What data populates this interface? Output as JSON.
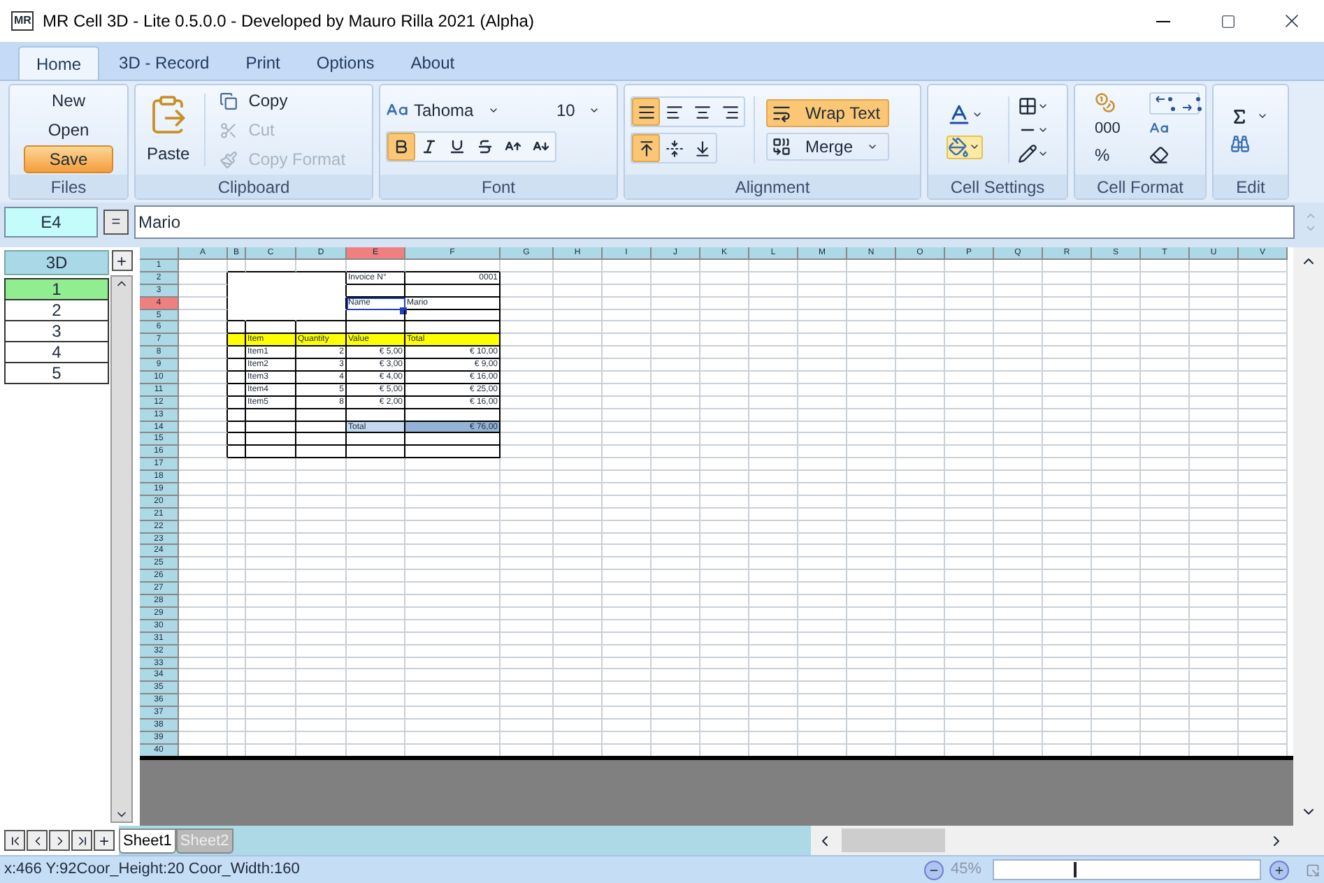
{
  "window": {
    "title": "MR Cell 3D - Lite 0.5.0.0 - Developed by Mauro Rilla 2021 (Alpha)",
    "app_icon": "MR"
  },
  "tabs": [
    {
      "label": "Home",
      "selected": true
    },
    {
      "label": "3D - Record",
      "selected": false
    },
    {
      "label": "Print",
      "selected": false
    },
    {
      "label": "Options",
      "selected": false
    },
    {
      "label": "About",
      "selected": false
    }
  ],
  "ribbon": {
    "files": {
      "label": "Files",
      "buttons": [
        {
          "label": "New",
          "active": false
        },
        {
          "label": "Open",
          "active": false
        },
        {
          "label": "Save",
          "active": true
        }
      ]
    },
    "clipboard": {
      "label": "Clipboard",
      "paste": "Paste",
      "items": [
        {
          "kind": "copy",
          "label": "Copy",
          "disabled": false
        },
        {
          "kind": "cut",
          "label": "Cut",
          "disabled": true
        },
        {
          "kind": "format",
          "label": "Copy Format",
          "disabled": true
        }
      ]
    },
    "font": {
      "label": "Font",
      "name": "Tahoma",
      "size": "10",
      "styles": [
        {
          "kind": "bold",
          "active": true
        },
        {
          "kind": "italic",
          "active": false
        },
        {
          "kind": "underline",
          "active": false
        },
        {
          "kind": "strike",
          "active": false
        },
        {
          "kind": "grow",
          "active": false
        },
        {
          "kind": "shrink",
          "active": false
        }
      ]
    },
    "alignment": {
      "label": "Alignment",
      "horizontal": [
        {
          "kind": "auto",
          "active": true
        },
        {
          "kind": "left",
          "active": false
        },
        {
          "kind": "center",
          "active": false
        },
        {
          "kind": "right",
          "active": false
        }
      ],
      "vertical": [
        {
          "kind": "top",
          "active": true
        },
        {
          "kind": "middle",
          "active": false
        },
        {
          "kind": "bottom",
          "active": false
        }
      ],
      "wrap": {
        "label": "Wrap Text",
        "active": true
      },
      "merge": {
        "label": "Merge"
      }
    },
    "cell_settings": {
      "label": "Cell Settings",
      "fill_active": true
    },
    "cell_format": {
      "label": "Cell Format",
      "thousands": "000",
      "percent": "%"
    },
    "edit": {
      "label": "Edit"
    }
  },
  "formula_bar": {
    "cell": "E4",
    "equals": "=",
    "value": "Mario"
  },
  "panel_3d": {
    "header": "3D",
    "add": "+",
    "items": [
      {
        "label": "1",
        "selected": true
      },
      {
        "label": "2",
        "selected": false
      },
      {
        "label": "3",
        "selected": false
      },
      {
        "label": "4",
        "selected": false
      },
      {
        "label": "5",
        "selected": false
      }
    ]
  },
  "grid": {
    "columns": [
      {
        "label": "A",
        "selected": false
      },
      {
        "label": "B",
        "selected": false
      },
      {
        "label": "C",
        "selected": false
      },
      {
        "label": "D",
        "selected": false
      },
      {
        "label": "E",
        "selected": true
      },
      {
        "label": "F",
        "selected": false
      },
      {
        "label": "G",
        "selected": false
      },
      {
        "label": "H",
        "selected": false
      },
      {
        "label": "I",
        "selected": false
      },
      {
        "label": "J",
        "selected": false
      },
      {
        "label": "K",
        "selected": false
      },
      {
        "label": "L",
        "selected": false
      },
      {
        "label": "M",
        "selected": false
      },
      {
        "label": "N",
        "selected": false
      },
      {
        "label": "O",
        "selected": false
      },
      {
        "label": "P",
        "selected": false
      },
      {
        "label": "Q",
        "selected": false
      },
      {
        "label": "R",
        "selected": false
      },
      {
        "label": "S",
        "selected": false
      },
      {
        "label": "T",
        "selected": false
      },
      {
        "label": "U",
        "selected": false
      },
      {
        "label": "V",
        "selected": false
      }
    ],
    "rows": [
      {
        "label": "1",
        "selected": false
      },
      {
        "label": "2",
        "selected": false,
        "cells": {
          "E": {
            "text": "Invoice N°",
            "kind": "text"
          },
          "F": {
            "text": "0001",
            "kind": "number"
          }
        }
      },
      {
        "label": "3",
        "selected": false
      },
      {
        "label": "4",
        "selected": true,
        "cells": {
          "E": {
            "text": "Name",
            "kind": "text",
            "selected": true
          },
          "F": {
            "text": "Mario",
            "kind": "text"
          }
        }
      },
      {
        "label": "5",
        "selected": false
      },
      {
        "label": "6",
        "selected": false
      },
      {
        "label": "7",
        "selected": false,
        "cells": {
          "B": {
            "color": "#ffff00"
          },
          "C": {
            "text": "Item",
            "kind": "text",
            "color": "#ffff00"
          },
          "D": {
            "text": "Quantity",
            "kind": "text",
            "color": "#ffff00"
          },
          "E": {
            "text": "Value",
            "kind": "text",
            "color": "#ffff00"
          },
          "F": {
            "text": "Total",
            "kind": "text",
            "color": "#ffff00"
          }
        }
      },
      {
        "label": "8",
        "selected": false,
        "cells": {
          "C": {
            "text": "Item1",
            "kind": "text"
          },
          "D": {
            "text": "2",
            "kind": "number"
          },
          "E": {
            "text": "€ 5,00",
            "kind": "number"
          },
          "F": {
            "text": "€ 10,00",
            "kind": "number"
          }
        }
      },
      {
        "label": "9",
        "selected": false,
        "cells": {
          "C": {
            "text": "Item2",
            "kind": "text"
          },
          "D": {
            "text": "3",
            "kind": "number"
          },
          "E": {
            "text": "€ 3,00",
            "kind": "number"
          },
          "F": {
            "text": "€ 9,00",
            "kind": "number"
          }
        }
      },
      {
        "label": "10",
        "selected": false,
        "cells": {
          "C": {
            "text": "Item3",
            "kind": "text"
          },
          "D": {
            "text": "4",
            "kind": "number"
          },
          "E": {
            "text": "€ 4,00",
            "kind": "number"
          },
          "F": {
            "text": "€ 16,00",
            "kind": "number"
          }
        }
      },
      {
        "label": "11",
        "selected": false,
        "cells": {
          "C": {
            "text": "Item4",
            "kind": "text"
          },
          "D": {
            "text": "5",
            "kind": "number"
          },
          "E": {
            "text": "€ 5,00",
            "kind": "number"
          },
          "F": {
            "text": "€ 25,00",
            "kind": "number"
          }
        }
      },
      {
        "label": "12",
        "selected": false,
        "cells": {
          "C": {
            "text": "Item5",
            "kind": "text"
          },
          "D": {
            "text": "8",
            "kind": "number"
          },
          "E": {
            "text": "€ 2,00",
            "kind": "number"
          },
          "F": {
            "text": "€ 16,00",
            "kind": "number"
          }
        }
      },
      {
        "label": "13",
        "selected": false
      },
      {
        "label": "14",
        "selected": false,
        "cells": {
          "E": {
            "text": "Total",
            "kind": "text",
            "color": "#c5d9f1"
          },
          "F": {
            "text": "€ 76,00",
            "kind": "number",
            "color": "#95b3d7"
          }
        }
      },
      {
        "label": "15",
        "selected": false
      },
      {
        "label": "16",
        "selected": false
      },
      {
        "label": "17",
        "selected": false
      },
      {
        "label": "18",
        "selected": false
      },
      {
        "label": "19",
        "selected": false
      },
      {
        "label": "20",
        "selected": false
      },
      {
        "label": "21",
        "selected": false
      },
      {
        "label": "22",
        "selected": false
      },
      {
        "label": "23",
        "selected": false
      },
      {
        "label": "24",
        "selected": false
      },
      {
        "label": "25",
        "selected": false
      },
      {
        "label": "26",
        "selected": false
      },
      {
        "label": "27",
        "selected": false
      },
      {
        "label": "28",
        "selected": false
      },
      {
        "label": "29",
        "selected": false
      },
      {
        "label": "30",
        "selected": false
      },
      {
        "label": "31",
        "selected": false
      },
      {
        "label": "32",
        "selected": false
      },
      {
        "label": "33",
        "selected": false
      },
      {
        "label": "34",
        "selected": false
      },
      {
        "label": "35",
        "selected": false
      },
      {
        "label": "36",
        "selected": false
      },
      {
        "label": "37",
        "selected": false
      },
      {
        "label": "38",
        "selected": false
      },
      {
        "label": "39",
        "selected": false
      },
      {
        "label": "40",
        "selected": false
      }
    ]
  },
  "sheets": {
    "add": "+",
    "tabs": [
      {
        "label": "Sheet1",
        "selected": true
      },
      {
        "label": "Sheet2",
        "selected": false
      }
    ]
  },
  "status_bar": {
    "text": "x:466 Y:92Coor_Height:20 Coor_Width:160",
    "zoom": "45%",
    "level": 0.3
  }
}
